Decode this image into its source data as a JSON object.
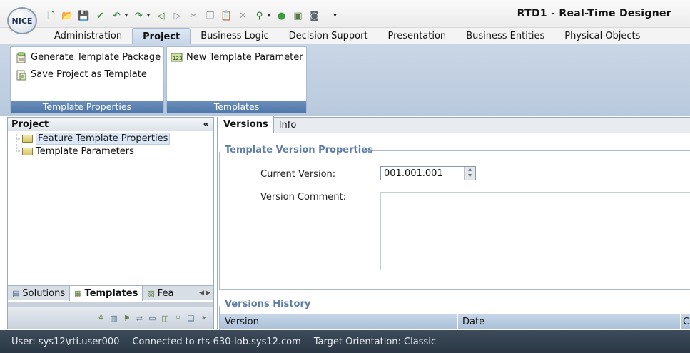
{
  "app": {
    "logo_text": "NICE",
    "title": "RTD1 - Real-Time Designer"
  },
  "quick_access": [
    {
      "icon": "new-file-icon",
      "glyph": "🗋",
      "color": "#4a8a2c"
    },
    {
      "icon": "open-folder-icon",
      "glyph": "📂",
      "color": "#b48a1e"
    },
    {
      "icon": "save-icon",
      "glyph": "💾",
      "color": "#3a5f8f"
    },
    {
      "icon": "checkin-icon",
      "glyph": "✔",
      "color": "#3d8f3a"
    },
    {
      "icon": "undo-icon",
      "glyph": "↶",
      "color": "#2e7d32"
    },
    {
      "icon": "redo-icon",
      "glyph": "↷",
      "color": "#2e7d32"
    },
    {
      "icon": "back-icon",
      "glyph": "◁",
      "color": "#4a7a2a"
    },
    {
      "icon": "forward-icon",
      "glyph": "▷",
      "color": "#9aa0a6"
    },
    {
      "icon": "cut-icon",
      "glyph": "✂",
      "color": "#9aa0a6"
    },
    {
      "icon": "copy-icon",
      "glyph": "❐",
      "color": "#9aa0a6"
    },
    {
      "icon": "paste-icon",
      "glyph": "📋",
      "color": "#9aa0a6"
    },
    {
      "icon": "delete-icon",
      "glyph": "✕",
      "color": "#9aa0a6"
    },
    {
      "icon": "find-icon",
      "glyph": "⚲",
      "color": "#2e6f2e"
    },
    {
      "icon": "run-icon",
      "glyph": "●",
      "color": "#3f9a3f"
    },
    {
      "icon": "deploy-icon",
      "glyph": "▣",
      "color": "#5c7a4a"
    },
    {
      "icon": "snapshot-icon",
      "glyph": "◙",
      "color": "#5c6670"
    }
  ],
  "tabs": [
    {
      "label": "Administration",
      "active": false
    },
    {
      "label": "Project",
      "active": true
    },
    {
      "label": "Business Logic",
      "active": false
    },
    {
      "label": "Decision Support",
      "active": false
    },
    {
      "label": "Presentation",
      "active": false
    },
    {
      "label": "Business Entities",
      "active": false
    },
    {
      "label": "Physical Objects",
      "active": false
    }
  ],
  "ribbon": {
    "template_properties": {
      "footer": "Template Properties",
      "items": [
        {
          "label": "Generate Template Package",
          "icon": "generate-package-icon"
        },
        {
          "label": "Save Project as Template",
          "icon": "save-template-icon"
        }
      ]
    },
    "templates": {
      "footer": "Templates",
      "items": [
        {
          "label": "New Template Parameter",
          "icon": "template-parameter-icon"
        }
      ]
    }
  },
  "left_panel": {
    "title": "Project",
    "collapse_glyph": "«",
    "tree": [
      {
        "label": "Feature Template Properties",
        "selected": true
      },
      {
        "label": "Template Parameters",
        "selected": false
      }
    ],
    "bottom_tabs": [
      {
        "label": "Solutions",
        "active": false
      },
      {
        "label": "Templates",
        "active": true
      },
      {
        "label": "Fea",
        "active": false
      }
    ]
  },
  "right_panel": {
    "tabs": [
      {
        "label": "Versions",
        "active": true
      },
      {
        "label": "Info",
        "active": false
      }
    ],
    "version_section_title": "Template Version Properties",
    "current_version_label": "Current Version:",
    "current_version_value": "001.001.001",
    "version_comment_label": "Version Comment:",
    "version_comment_value": "",
    "history_title": "Versions History",
    "history_columns": [
      "Version",
      "Date",
      "C"
    ]
  },
  "status": {
    "user": "User: sys12\\rti.user000",
    "connection": "Connected to rts-630-lob.sys12.com",
    "orientation": "Target Orientation: Classic"
  }
}
